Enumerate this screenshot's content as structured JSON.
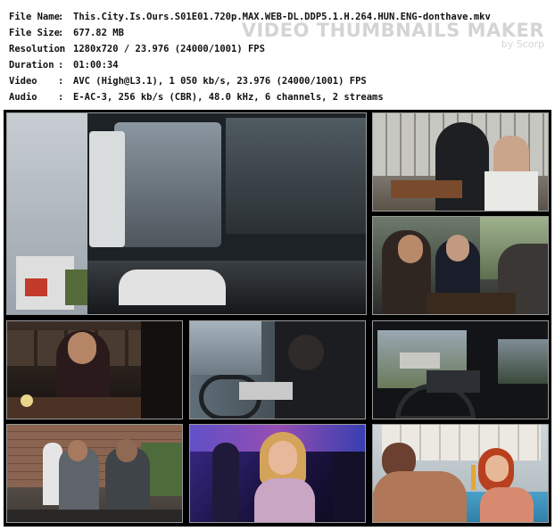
{
  "file_info": [
    {
      "key": "File Name",
      "value": "This.City.Is.Ours.S01E01.720p.MAX.WEB-DL.DDP5.1.H.264.HUN.ENG-donthave.mkv"
    },
    {
      "key": "File Size",
      "value": "677.82 MB"
    },
    {
      "key": "Resolution",
      "value": "1280x720 / 23.976 (24000/1001) FPS"
    },
    {
      "key": "Duration",
      "value": "01:00:34"
    },
    {
      "key": "Video",
      "value": "AVC (High@L3.1), 1 050 kb/s, 23.976 (24000/1001) FPS"
    },
    {
      "key": "Audio",
      "value": "E-AC-3, 256 kb/s (CBR), 48.0 kHz, 6 channels, 2 streams"
    }
  ],
  "watermark": {
    "title": "VIDEO THUMBNAILS MAKER",
    "byline": "by Scorp"
  },
  "thumbnails": [
    "thumbnail-truck-cab",
    "thumbnail-cafe-conversation",
    "thumbnail-pub-table",
    "thumbnail-man-at-table",
    "thumbnail-driver-wheel",
    "thumbnail-car-window",
    "thumbnail-street-group",
    "thumbnail-club-woman",
    "thumbnail-pool-couple"
  ],
  "colors": {
    "sheet_bg": "#000000",
    "thumb_border": "#9a9a9a",
    "watermark": "#d4d4d4"
  }
}
